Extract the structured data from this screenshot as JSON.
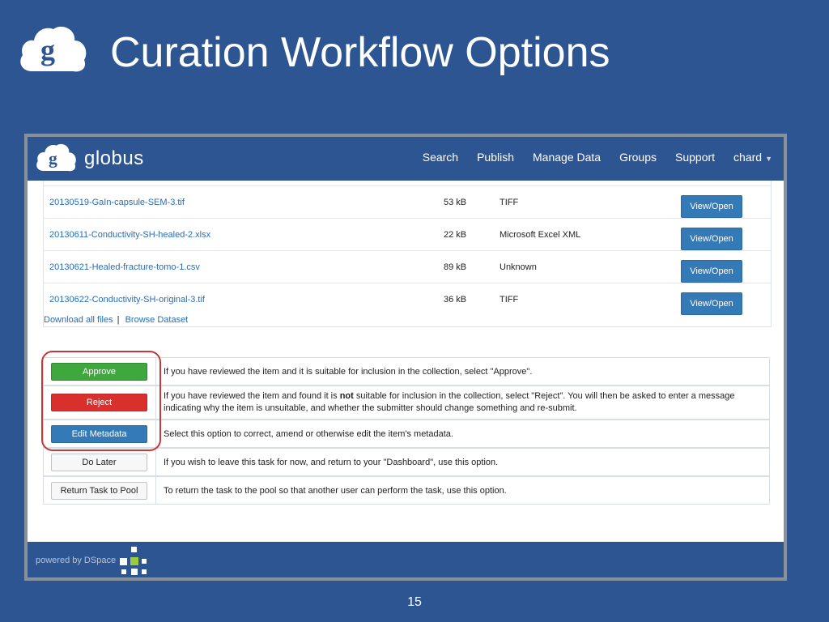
{
  "slide": {
    "title": "Curation Workflow Options",
    "page_number": "15"
  },
  "nav": {
    "brand": "globus",
    "links": [
      "Search",
      "Publish",
      "Manage Data",
      "Groups",
      "Support"
    ],
    "user": "chard"
  },
  "files": [
    {
      "name": "20130519-GaIn-capsule-SEM-3.tif",
      "size": "53 kB",
      "type": "TIFF",
      "action": "View/Open"
    },
    {
      "name": "20130611-Conductivity-SH-healed-2.xlsx",
      "size": "22 kB",
      "type": "Microsoft Excel XML",
      "action": "View/Open"
    },
    {
      "name": "20130621-Healed-fracture-tomo-1.csv",
      "size": "89 kB",
      "type": "Unknown",
      "action": "View/Open"
    },
    {
      "name": "20130622-Conductivity-SH-original-3.tif",
      "size": "36 kB",
      "type": "TIFF",
      "action": "View/Open"
    }
  ],
  "file_links": {
    "download_all": "Download all files",
    "separator": "|",
    "browse": "Browse Dataset"
  },
  "workflow": {
    "approve": {
      "label": "Approve",
      "description": "If you have reviewed the item and it is suitable for inclusion in the collection, select \"Approve\"."
    },
    "reject": {
      "label": "Reject",
      "desc_before": "If you have reviewed the item and found it is ",
      "desc_bold": "not",
      "desc_after": " suitable for inclusion in the collection, select \"Reject\". You will then be asked to enter a message indicating why the item is unsuitable, and whether the submitter should change something and re-submit."
    },
    "edit": {
      "label": "Edit Metadata",
      "description": "Select this option to correct, amend or otherwise edit the item's metadata."
    },
    "later": {
      "label": "Do Later",
      "description": "If you wish to leave this task for now, and return to your \"Dashboard\", use this option."
    },
    "return": {
      "label": "Return Task to Pool",
      "description": "To return the task to the pool so that another user can perform the task, use this option."
    }
  },
  "footer": {
    "powered_by": "powered by DSpace"
  },
  "colors": {
    "brand_blue": "#2c5592",
    "link": "#2a6db3",
    "approve": "#3ea83f",
    "reject": "#d9302e",
    "primary": "#337ab7",
    "highlight": "#c0393b"
  }
}
